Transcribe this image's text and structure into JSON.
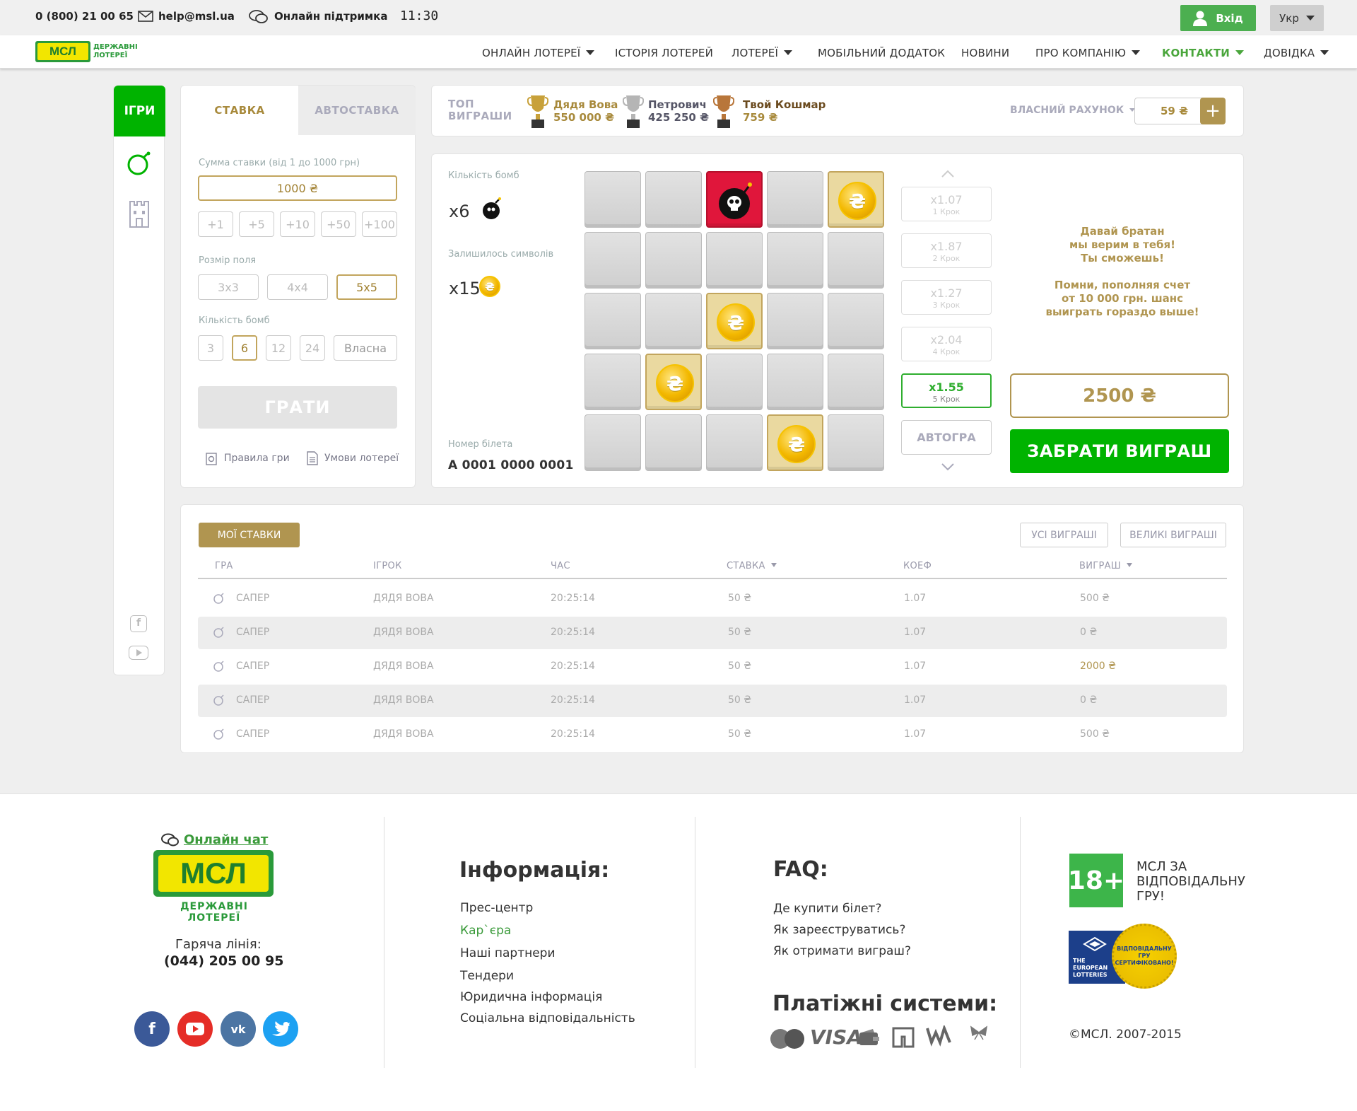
{
  "topbar": {
    "phone": "0 (800) 21 00 65",
    "email": "help@msl.ua",
    "support": "Онлайн підтримка",
    "time": "11:30",
    "login_label": "Вхід",
    "lang": "Укр"
  },
  "logo": {
    "text": "МСЛ",
    "subtitle_line1": "ДЕРЖАВНІ",
    "subtitle_line2": "ЛОТЕРЕЇ"
  },
  "nav": [
    {
      "label": "ОНЛАЙН ЛОТЕРЕЇ"
    },
    {
      "label": "ІСТОРІЯ ЛОТЕРЕЙ"
    },
    {
      "label": "ЛОТЕРЕЇ"
    },
    {
      "label": "МОБІЛЬНИЙ ДОДАТОК"
    },
    {
      "label": "НОВИНИ"
    },
    {
      "label": "ПРО КОМПАНІЮ"
    },
    {
      "label": "КОНТАКТИ"
    },
    {
      "label": "ДОВІДКА"
    }
  ],
  "sidebar": {
    "title": "ІГРИ"
  },
  "bet": {
    "tab_bet": "СТАВКА",
    "tab_auto": "АВТОСТАВКА",
    "amount_label": "Сумма ставки (від 1 до 1000 грн)",
    "amount_value": "1000 ₴",
    "increments": [
      "+1",
      "+5",
      "+10",
      "+50",
      "+100"
    ],
    "field_label": "Розмір поля",
    "field_sizes": [
      "3x3",
      "4x4",
      "5x5"
    ],
    "bombs_label": "Кількість бомб",
    "bomb_options": [
      "3",
      "6",
      "12",
      "24",
      "Власна"
    ],
    "play_label": "ГРАТИ",
    "rules": "Правила гри",
    "terms": "Умови лотереї"
  },
  "top_wins": {
    "title_line1": "ТОП",
    "title_line2": "ВИГРАШИ",
    "entries": [
      {
        "name": "Дядя Вова",
        "amount": "550 000 ₴"
      },
      {
        "name": "Петрович",
        "amount": "425 250 ₴"
      },
      {
        "name": "Твой Кошмар",
        "amount": "759 ₴"
      }
    ],
    "account_label": "ВЛАСНИЙ РАХУНОК",
    "balance": "59 ₴",
    "add_label": "+"
  },
  "game": {
    "bombs_label": "Кількість бомб",
    "bombs_value": "x6",
    "left_label": "Залишилось символів",
    "left_value": "x15",
    "ticket_label": "Номер білета",
    "ticket_value": "A 0001 0000 0001",
    "coin_symbol": "₴",
    "steps": [
      {
        "mult": "x1.07",
        "step": "1 Крок"
      },
      {
        "mult": "x1.87",
        "step": "2 Крок"
      },
      {
        "mult": "x1.27",
        "step": "3 Крок"
      },
      {
        "mult": "x2.04",
        "step": "4 Крок"
      },
      {
        "mult": "x1.55",
        "step": "5 Крок"
      }
    ],
    "auto_label": "АВТОГРА",
    "message_line1": "Давай братан",
    "message_line2": "мы верим в тебя!",
    "message_line3": "Ты сможешь!",
    "message_line4": "Помни, пополняя счет",
    "message_line5": "от 10 000 грн. шанс",
    "message_line6": "выиграть гораздо выше!",
    "win_amount": "2500 ₴",
    "collect_label": "ЗАБРАТИ ВИГРАШ",
    "colors": {
      "accent_green": "#00b300",
      "gold": "#c2a55d",
      "bomb_red": "#e0163b"
    }
  },
  "history": {
    "my_bets": "МОЇ СТАВКИ",
    "all_wins": "УСІ ВИГРАШІ",
    "big_wins": "ВЕЛИКІ ВИГРАШІ",
    "columns": [
      "ГРА",
      "ІГРОК",
      "ЧАС",
      "СТАВКА",
      "КОЕФ",
      "ВИГРАШ"
    ],
    "rows": [
      {
        "game": "САПЕР",
        "player": "ДЯДЯ ВОВА",
        "time": "20:25:14",
        "bet": "50 ₴",
        "coef": "1.07",
        "win": "500 ₴"
      },
      {
        "game": "САПЕР",
        "player": "ДЯДЯ ВОВА",
        "time": "20:25:14",
        "bet": "50 ₴",
        "coef": "1.07",
        "win": "0 ₴"
      },
      {
        "game": "САПЕР",
        "player": "ДЯДЯ ВОВА",
        "time": "20:25:14",
        "bet": "50 ₴",
        "coef": "1.07",
        "win": "2000 ₴"
      },
      {
        "game": "САПЕР",
        "player": "ДЯДЯ ВОВА",
        "time": "20:25:14",
        "bet": "50 ₴",
        "coef": "1.07",
        "win": "0 ₴"
      },
      {
        "game": "САПЕР",
        "player": "ДЯДЯ ВОВА",
        "time": "20:25:14",
        "bet": "50 ₴",
        "coef": "1.07",
        "win": "500 ₴"
      }
    ]
  },
  "footer": {
    "chat": "Онлайн чат",
    "hotline_label": "Гаряча лінія:",
    "hotline": "(044) 205 00 95",
    "info_title": "Інформація:",
    "info_links": [
      "Прес-центр",
      "Кар`єра",
      "Наші партнери",
      "Тендери",
      "Юридична інформація",
      "Соціальна відповідальність"
    ],
    "faq_title": "FAQ:",
    "faq_links": [
      "Де купити білет?",
      "Як зареєструватись?",
      "Як отримати виграш?"
    ],
    "pay_title": "Платіжні системи:",
    "age": "18+",
    "responsible_line1": "МСЛ ЗА",
    "responsible_line2": "ВІДПОВІДАЛЬНУ",
    "responsible_line3": "ГРУ!",
    "el_line1": "THE",
    "el_line2": "EUROPEAN",
    "el_line3": "LOTTERIES",
    "seal_line1": "ВІДПОВІДАЛЬНУ",
    "seal_line2": "ГРУ",
    "seal_line3": "СЕРТИФІКОВАНО!",
    "copyright": "©МСЛ. 2007-2015"
  }
}
